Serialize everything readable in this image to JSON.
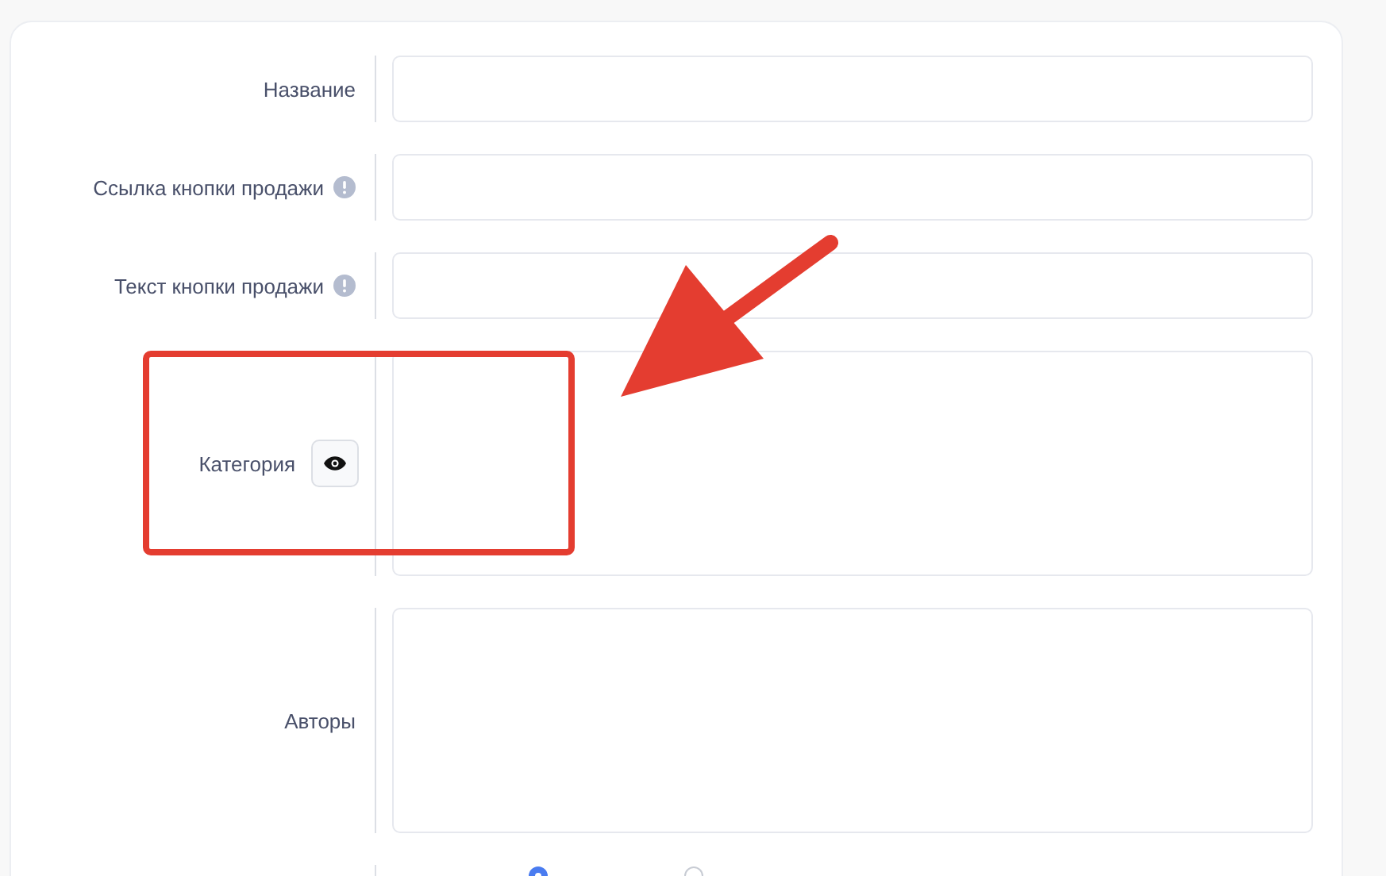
{
  "form": {
    "fields": [
      {
        "kind": "input",
        "label": "Название"
      },
      {
        "kind": "input_with_info",
        "label": "Ссылка кнопки продажи"
      },
      {
        "kind": "input_with_info",
        "label": "Текст кнопки продажи"
      },
      {
        "kind": "textarea_with_eye",
        "label": "Категория"
      },
      {
        "kind": "textarea",
        "label": "Авторы"
      },
      {
        "kind": "radios",
        "options": [
          {
            "selected": true
          },
          {
            "selected": false
          }
        ]
      }
    ]
  },
  "annotation": {
    "kind": "highlight_with_arrow"
  }
}
